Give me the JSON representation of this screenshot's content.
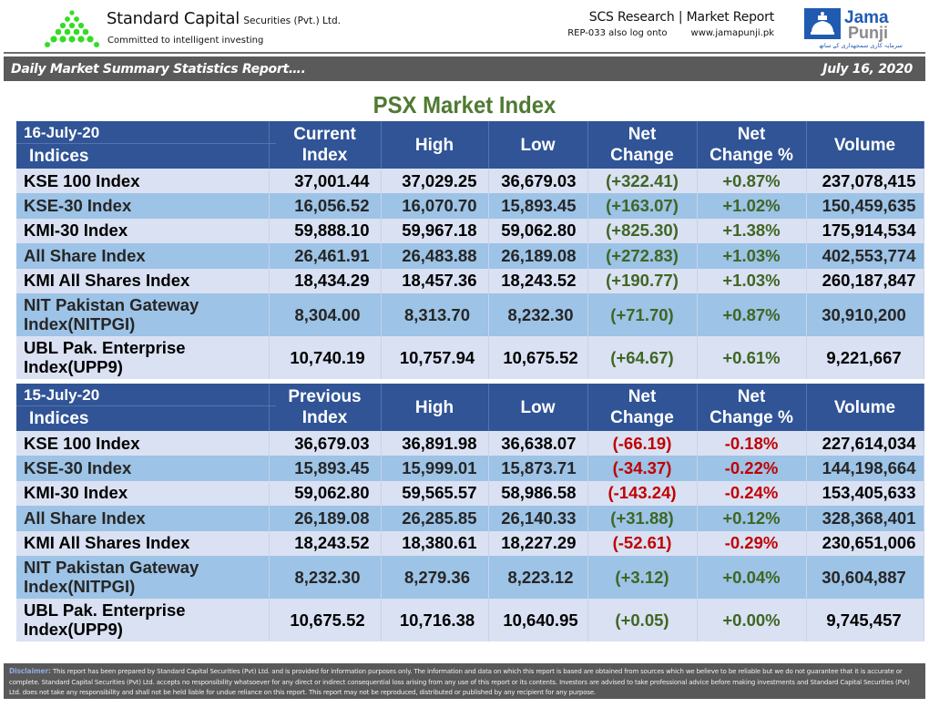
{
  "header": {
    "brand_name": "Standard Capital",
    "brand_suffix": "Securities (Pvt.) Ltd.",
    "tagline": "Committed to intelligent investing",
    "research_title": "SCS Research | Market Report",
    "report_ref": "REP-033 also log onto",
    "website": "www.jamapunji.pk",
    "partner_logo": {
      "line1": "Jama",
      "line2": "Punji",
      "urdu": "سرمایہ کاری سمجھداری کے ساتھ"
    },
    "colors": {
      "logo_green": "#33dd22",
      "jama_blue": "#1f5bb0",
      "punji_gray": "#8a8a8a"
    }
  },
  "report_bar": {
    "title": "Daily Market Summary Statistics Report….",
    "date": "July 16, 2020"
  },
  "section_title": "PSX Market Index",
  "tables": [
    {
      "date_label": "16-July-20",
      "indices_label": "Indices",
      "columns": [
        "Current Index",
        "High",
        "Low",
        "Net Change",
        "Net Change %",
        "Volume"
      ],
      "column_lines": [
        [
          "Current",
          "Index"
        ],
        [
          "High"
        ],
        [
          "Low"
        ],
        [
          "Net",
          "Change"
        ],
        [
          "Net",
          "Change %"
        ],
        [
          "Volume"
        ]
      ],
      "rows": [
        {
          "name": [
            "KSE 100 Index"
          ],
          "index": "37,001.44",
          "high": "37,029.25",
          "low": "36,679.03",
          "change": "(+322.41)",
          "change_pct": "+0.87%",
          "volume": "237,078,415",
          "direction": "up"
        },
        {
          "name": [
            "KSE-30 Index"
          ],
          "index": "16,056.52",
          "high": "16,070.70",
          "low": "15,893.45",
          "change": "(+163.07)",
          "change_pct": "+1.02%",
          "volume": "150,459,635",
          "direction": "up"
        },
        {
          "name": [
            "KMI-30 Index"
          ],
          "index": "59,888.10",
          "high": "59,967.18",
          "low": "59,062.80",
          "change": "(+825.30)",
          "change_pct": "+1.38%",
          "volume": "175,914,534",
          "direction": "up"
        },
        {
          "name": [
            "All Share Index"
          ],
          "index": "26,461.91",
          "high": "26,483.88",
          "low": "26,189.08",
          "change": "(+272.83)",
          "change_pct": "+1.03%",
          "volume": "402,553,774",
          "direction": "up"
        },
        {
          "name": [
            "KMI All Shares Index"
          ],
          "index": "18,434.29",
          "high": "18,457.36",
          "low": "18,243.52",
          "change": "(+190.77)",
          "change_pct": "+1.03%",
          "volume": "260,187,847",
          "direction": "up"
        },
        {
          "name": [
            "NIT Pakistan Gateway",
            "Index(NITPGI)"
          ],
          "index": "8,304.00",
          "high": "8,313.70",
          "low": "8,232.30",
          "change": "(+71.70)",
          "change_pct": "+0.87%",
          "volume": "30,910,200",
          "direction": "up"
        },
        {
          "name": [
            "UBL Pak. Enterprise",
            "Index(UPP9)"
          ],
          "index": "10,740.19",
          "high": "10,757.94",
          "low": "10,675.52",
          "change": "(+64.67)",
          "change_pct": "+0.61%",
          "volume": "9,221,667",
          "direction": "up"
        }
      ]
    },
    {
      "date_label": "15-July-20",
      "indices_label": "Indices",
      "columns": [
        "Previous Index",
        "High",
        "Low",
        "Net Change",
        "Net Change %",
        "Volume"
      ],
      "column_lines": [
        [
          "Previous",
          "Index"
        ],
        [
          "High"
        ],
        [
          "Low"
        ],
        [
          "Net",
          "Change"
        ],
        [
          "Net",
          "Change %"
        ],
        [
          "Volume"
        ]
      ],
      "rows": [
        {
          "name": [
            "KSE 100 Index"
          ],
          "index": "36,679.03",
          "high": "36,891.98",
          "low": "36,638.07",
          "change": "(-66.19)",
          "change_pct": "-0.18%",
          "volume": "227,614,034",
          "direction": "down"
        },
        {
          "name": [
            "KSE-30 Index"
          ],
          "index": "15,893.45",
          "high": "15,999.01",
          "low": "15,873.71",
          "change": "(-34.37)",
          "change_pct": "-0.22%",
          "volume": "144,198,664",
          "direction": "down"
        },
        {
          "name": [
            "KMI-30 Index"
          ],
          "index": "59,062.80",
          "high": "59,565.57",
          "low": "58,986.58",
          "change": "(-143.24)",
          "change_pct": "-0.24%",
          "volume": "153,405,633",
          "direction": "down"
        },
        {
          "name": [
            "All Share Index"
          ],
          "index": "26,189.08",
          "high": "26,285.85",
          "low": "26,140.33",
          "change": "(+31.88)",
          "change_pct": "+0.12%",
          "volume": "328,368,401",
          "direction": "up"
        },
        {
          "name": [
            "KMI All Shares Index"
          ],
          "index": "18,243.52",
          "high": "18,380.61",
          "low": "18,227.29",
          "change": "(-52.61)",
          "change_pct": "-0.29%",
          "volume": "230,651,006",
          "direction": "down"
        },
        {
          "name": [
            "NIT Pakistan Gateway",
            "Index(NITPGI)"
          ],
          "index": "8,232.30",
          "high": "8,279.36",
          "low": "8,223.12",
          "change": "(+3.12)",
          "change_pct": "+0.04%",
          "volume": "30,604,887",
          "direction": "up"
        },
        {
          "name": [
            "UBL Pak. Enterprise",
            "Index(UPP9)"
          ],
          "index": "10,675.52",
          "high": "10,716.38",
          "low": "10,640.95",
          "change": "(+0.05)",
          "change_pct": "+0.00%",
          "volume": "9,745,457",
          "direction": "up"
        }
      ]
    }
  ],
  "status_colors": {
    "up": "#3f6624",
    "down": "#c00000",
    "header_bg": "#305496",
    "row_light": "#dae1f2",
    "row_dark": "#9dc3e6",
    "title_green": "#4f7a32"
  },
  "disclaimer": {
    "label": "Disclaimer:",
    "text": "This report has been prepared by Standard Capital Securities (Pvt) Ltd. and is provided for information purposes only. The information and data on which this report is based are obtained from sources which we believe to be reliable but we do not guarantee that it is accurate or complete. Standard Capital Securities (Pvt) Ltd. accepts no responsibility whatsoever for any direct or indirect consequential loss arising from any use of this report or its contents. Investors are advised to take professional advice before making investments and Standard Capital Securities (Pvt) Ltd. does not take any responsibility and shall not be held liable for undue reliance on this report. This report may not be reproduced, distributed or published by any recipient for any purpose."
  }
}
